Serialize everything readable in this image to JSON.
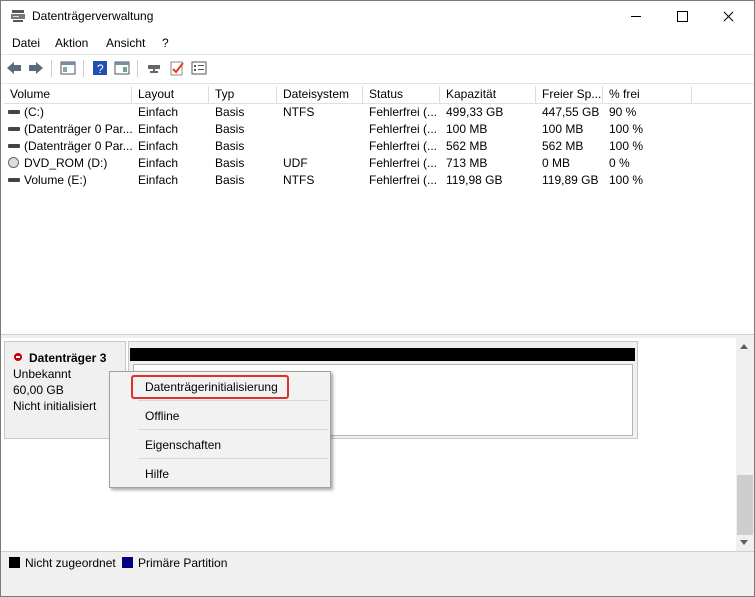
{
  "window": {
    "title": "Datenträgerverwaltung"
  },
  "menu": [
    "Datei",
    "Aktion",
    "Ansicht",
    "?"
  ],
  "toolbar_icons": [
    "back-arrow-icon",
    "forward-arrow-icon",
    "console-tree-icon",
    "help-icon",
    "action-pane-icon",
    "connect-icon",
    "check-icon",
    "properties-icon"
  ],
  "columns": [
    "Volume",
    "Layout",
    "Typ",
    "Dateisystem",
    "Status",
    "Kapazität",
    "Freier Sp...",
    "% frei"
  ],
  "rows": [
    {
      "volume": "(C:)",
      "layout": "Einfach",
      "typ": "Basis",
      "fs": "NTFS",
      "status": "Fehlerfrei (...",
      "kap": "499,33 GB",
      "frei": "447,55 GB",
      "pct": "90 %",
      "icon": "drive"
    },
    {
      "volume": "(Datenträger 0 Par...",
      "layout": "Einfach",
      "typ": "Basis",
      "fs": "",
      "status": "Fehlerfrei (...",
      "kap": "100 MB",
      "frei": "100 MB",
      "pct": "100 %",
      "icon": "drive"
    },
    {
      "volume": "(Datenträger 0 Par...",
      "layout": "Einfach",
      "typ": "Basis",
      "fs": "",
      "status": "Fehlerfrei (...",
      "kap": "562 MB",
      "frei": "562 MB",
      "pct": "100 %",
      "icon": "drive"
    },
    {
      "volume": "DVD_ROM (D:)",
      "layout": "Einfach",
      "typ": "Basis",
      "fs": "UDF",
      "status": "Fehlerfrei (...",
      "kap": "713 MB",
      "frei": "0 MB",
      "pct": "0 %",
      "icon": "dvd"
    },
    {
      "volume": "Volume (E:)",
      "layout": "Einfach",
      "typ": "Basis",
      "fs": "NTFS",
      "status": "Fehlerfrei (...",
      "kap": "119,98 GB",
      "frei": "119,89 GB",
      "pct": "100 %",
      "icon": "drive"
    }
  ],
  "disk": {
    "name": "Datenträger 3",
    "type": "Unbekannt",
    "size": "60,00 GB",
    "state": "Nicht initialisiert"
  },
  "context_menu": {
    "items": [
      "Datenträgerinitialisierung",
      "Offline",
      "Eigenschaften",
      "Hilfe"
    ],
    "highlighted_index": 0,
    "highlight_color": "#e0302b"
  },
  "legend": {
    "items": [
      {
        "label": "Nicht zugeordnet",
        "color": "#000000"
      },
      {
        "label": "Primäre Partition",
        "color": "#000080"
      }
    ]
  }
}
